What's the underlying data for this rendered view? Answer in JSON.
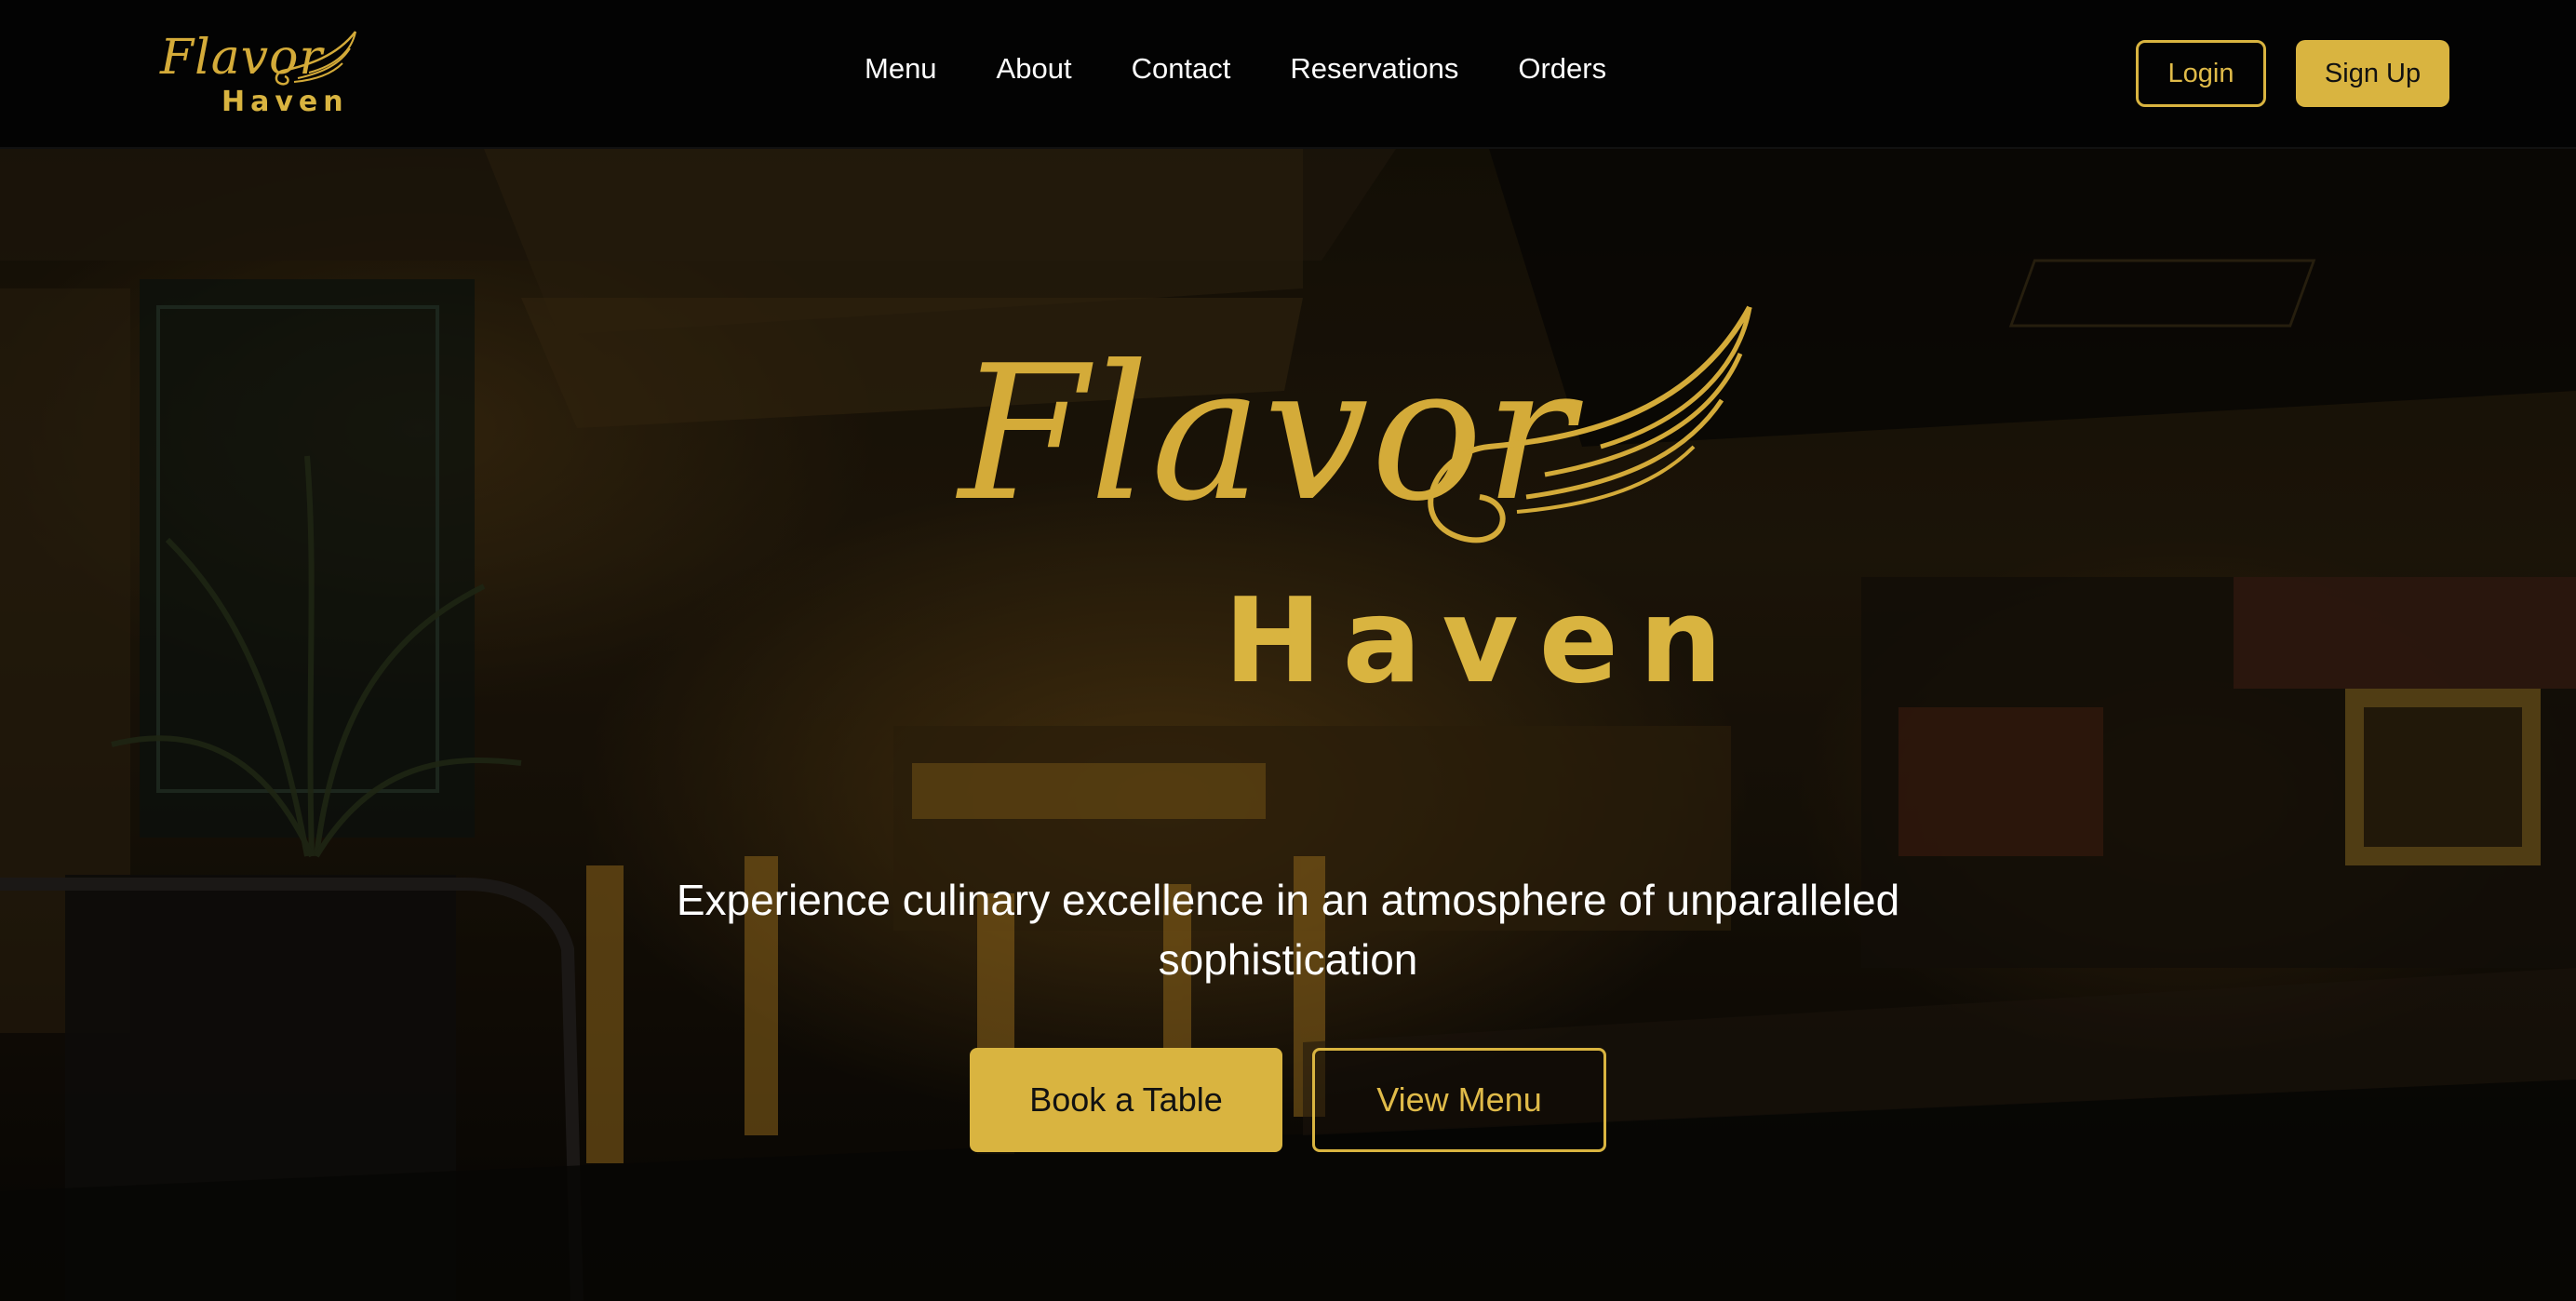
{
  "brand": {
    "script_word": "Flavor",
    "sub_word": "Haven",
    "accent_color": "#d9b440"
  },
  "nav": {
    "links": [
      "Menu",
      "About",
      "Contact",
      "Reservations",
      "Orders"
    ],
    "login_label": "Login",
    "signup_label": "Sign Up"
  },
  "hero": {
    "background": "dim restaurant bar interior photo",
    "tagline": "Experience culinary excellence in an atmosphere of unparalleled sophistication",
    "primary_button": "Book a Table",
    "secondary_button": "View Menu"
  },
  "icons": {
    "logo_mark": "wing-icon"
  }
}
